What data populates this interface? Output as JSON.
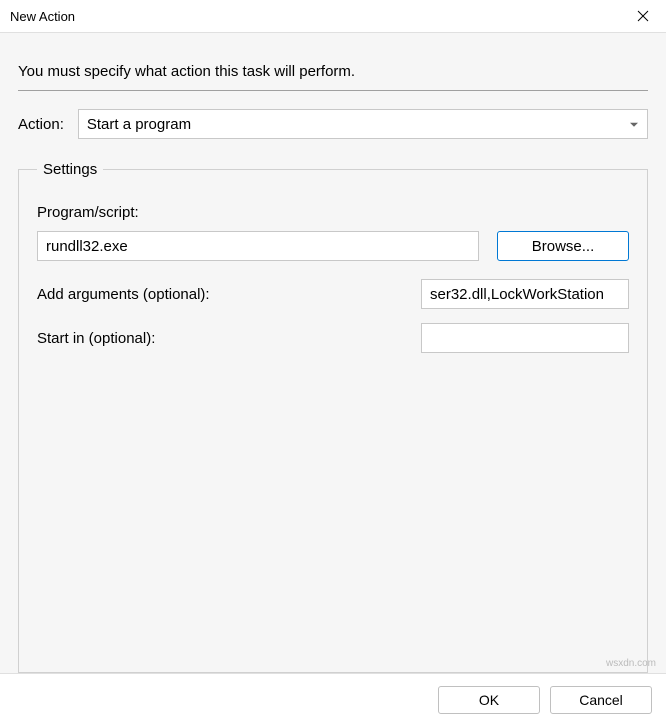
{
  "window": {
    "title": "New Action"
  },
  "instruction": "You must specify what action this task will perform.",
  "action": {
    "label": "Action:",
    "selected": "Start a program"
  },
  "settings": {
    "legend": "Settings",
    "program_label": "Program/script:",
    "program_value": "rundll32.exe",
    "browse_label": "Browse...",
    "arguments_label": "Add arguments (optional):",
    "arguments_value": "ser32.dll,LockWorkStation",
    "startin_label": "Start in (optional):",
    "startin_value": ""
  },
  "footer": {
    "ok": "OK",
    "cancel": "Cancel"
  },
  "watermark": "wsxdn.com"
}
